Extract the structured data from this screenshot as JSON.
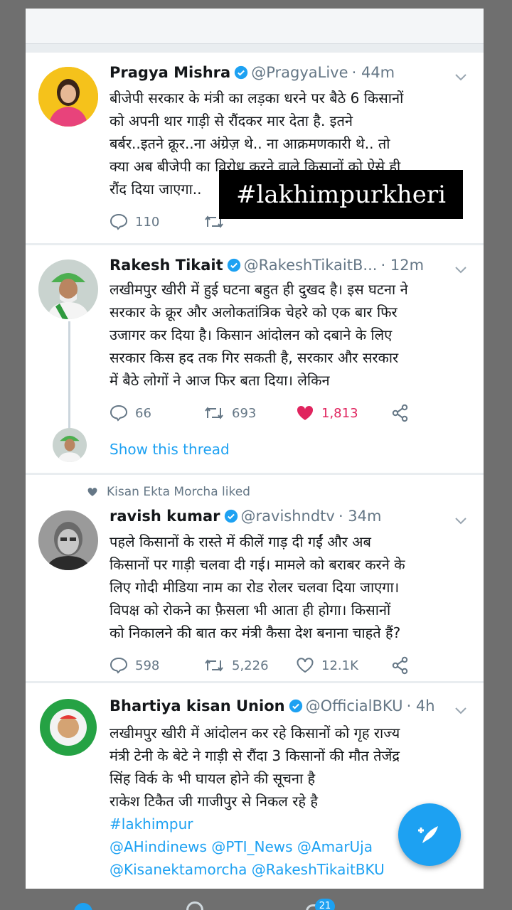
{
  "overlay": {
    "hashtag": "#lakhimpurkheri"
  },
  "tweets": [
    {
      "name": "Pragya Mishra",
      "handle": "@PragyaLive",
      "time": "· 44m",
      "lines": [
        "बीजेपी सरकार के मंत्री का लड़का धरने पर बैठे 6 किसानों",
        "को अपनी थार गाड़ी से रौंदकर मार देता है. इतने",
        "बर्बर..इतने क्रूर..ना अंग्रेज़ थे.. ना आक्रमणकारी थे.. तो",
        "क्या अब बीजेपी का विरोध करने वाले किसानों को ऐसे ही",
        "रौंद दिया जाएगा.."
      ],
      "replies": "110"
    },
    {
      "name": "Rakesh Tikait",
      "handle": "@RakeshTikaitB...",
      "time": "· 12m",
      "lines": [
        "लखीमपुर खीरी में हुई घटना बहुत ही दुखद है। इस घटना ने",
        "सरकार के क्रूर और अलोकतांत्रिक चेहरे को एक बार फिर",
        "उजागर कर दिया है। किसान आंदोलन को दबाने के लिए",
        "सरकार किस हद तक गिर सकती है, सरकार और सरकार",
        "में बैठे लोगों ने आज फिर बता दिया। लेकिन"
      ],
      "replies": "66",
      "retweets": "693",
      "likes": "1,813",
      "show_thread": "Show this thread"
    },
    {
      "liked_by": "Kisan Ekta Morcha liked",
      "name": "ravish kumar",
      "handle": "@ravishndtv",
      "time": "· 34m",
      "lines": [
        "पहले किसानों के रास्ते में कीलें गाड़ दी गईं और अब",
        "किसानों पर गाड़ी चलवा दी गई। मामले को बराबर करने के",
        "लिए गोदी मीडिया नाम का रोड रोलर चलवा दिया जाएगा।",
        "विपक्ष को रोकने का फ़ैसला भी आता ही होगा। किसानों",
        "को निकालने की बात कर मंत्री कैसा देश बनाना चाहते हैं?"
      ],
      "replies": "598",
      "retweets": "5,226",
      "likes": "12.1K"
    },
    {
      "name": "Bhartiya kisan Union",
      "handle": "@OfficialBKU",
      "time": "· 4h",
      "lines": [
        "लखीमपुर खीरी में आंदोलन कर रहे किसानों को गृह राज्य",
        "मंत्री टेनी के बेटे ने गाड़ी से रौंदा 3 किसानों की मौत  तेजेंद्र",
        "सिंह विर्क के भी घायल होने की सूचना है",
        "राकेश टिकैत जी गाजीपुर से निकल रहे है"
      ],
      "tags": [
        "#lakhimpur",
        "@AHindinews @PTI_News @AmarUja",
        "@Kisanektamorcha @RakeshTikaitBKU"
      ]
    }
  ],
  "nav": {
    "notifications_badge": "21"
  },
  "colors": {
    "accent": "#1da1f2",
    "like": "#e0245e",
    "text": "#14171a",
    "muted": "#657786"
  }
}
